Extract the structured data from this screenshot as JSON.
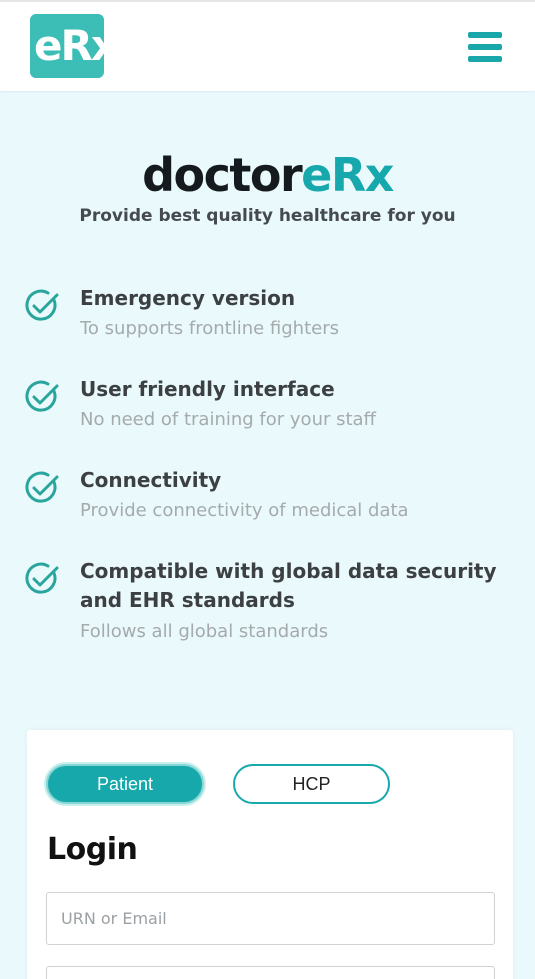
{
  "header": {
    "logo_text": "eRx",
    "menu_icon": "hamburger-menu-icon"
  },
  "hero": {
    "brand_dark": "doctor",
    "brand_teal": "eRx",
    "tagline": "Provide best quality healthcare for you"
  },
  "features": [
    {
      "title": "Emergency version",
      "subtitle": "To supports frontline fighters",
      "icon": "check-circle-icon"
    },
    {
      "title": "User friendly interface",
      "subtitle": "No need of training for your staff",
      "icon": "check-circle-icon"
    },
    {
      "title": "Connectivity",
      "subtitle": "Provide connectivity of medical data",
      "icon": "check-circle-icon"
    },
    {
      "title": "Compatible with global data security and EHR standards",
      "subtitle": "Follows all global standards",
      "icon": "check-circle-icon"
    }
  ],
  "login": {
    "tabs": [
      {
        "label": "Patient",
        "active": true
      },
      {
        "label": "HCP",
        "active": false
      }
    ],
    "title": "Login",
    "urn_placeholder": "URN or Email",
    "second_placeholder": ""
  },
  "colors": {
    "accent": "#17a8ac",
    "background": "#e9f9fc",
    "logo": "#3cbdb5",
    "check": "#2aa59d"
  }
}
